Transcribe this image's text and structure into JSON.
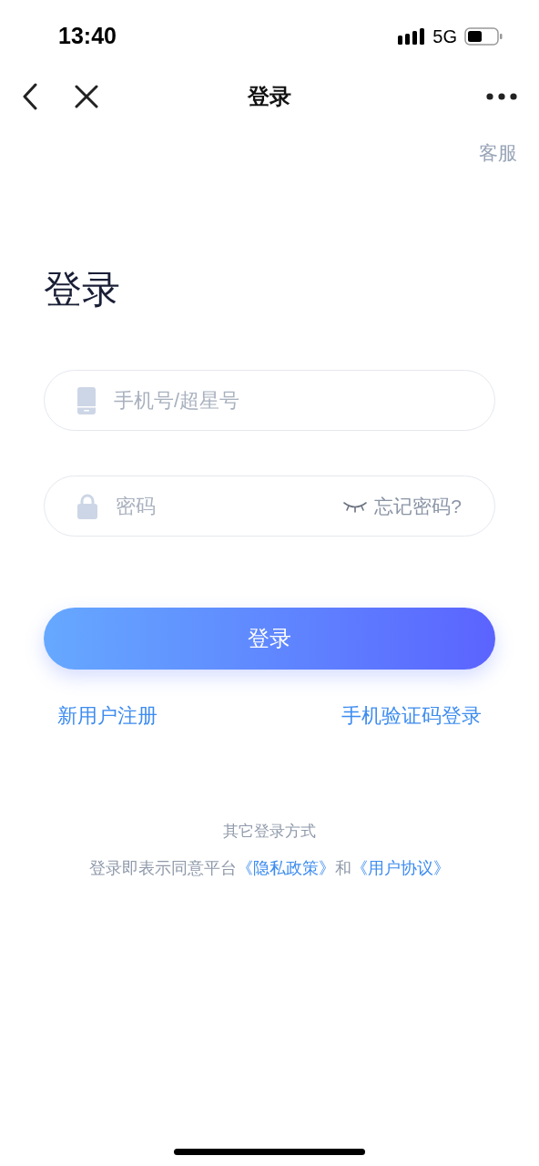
{
  "status_bar": {
    "time": "13:40",
    "network": "5G"
  },
  "nav_bar": {
    "title": "登录"
  },
  "support_link": "客服",
  "heading": "登录",
  "fields": [
    {
      "kind": "phone",
      "placeholder": "手机号/超星号"
    },
    {
      "kind": "password",
      "placeholder": "密码",
      "password_visible": false,
      "forgot_link": "忘记密码?"
    }
  ],
  "login_button": "登录",
  "links": [
    "新用户注册",
    "手机验证码登录"
  ],
  "other_methods": "其它登录方式",
  "agreement": {
    "prefix": "登录即表示同意平台",
    "privacy_link": "《隐私政策》",
    "joiner": "和",
    "terms_link": "《用户协议》"
  }
}
